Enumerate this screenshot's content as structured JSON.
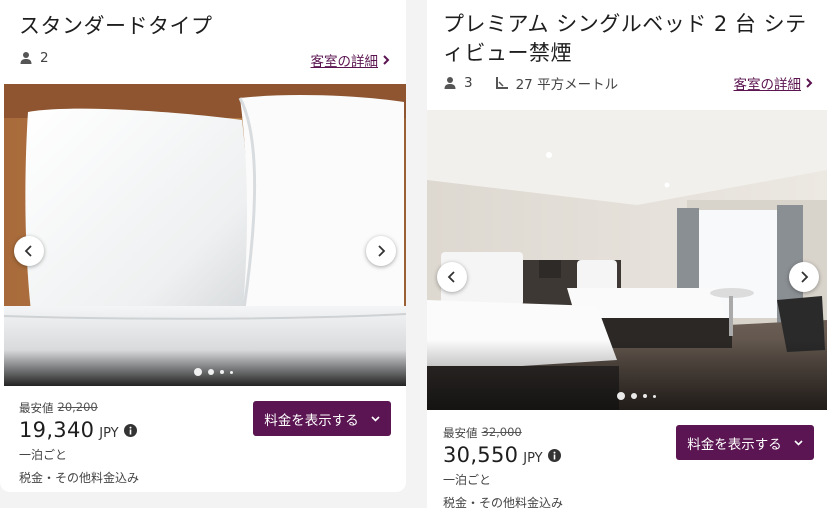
{
  "cards": [
    {
      "title": "スタンダードタイプ",
      "guests": "2",
      "details_link": "客室の詳細",
      "lowest_label": "最安値",
      "original_price": "20,200",
      "price": "19,340",
      "currency": "JPY",
      "per_night": "一泊ごと",
      "tax_note": "税金・その他料金込み",
      "rates_button": "料金を表示する",
      "image_index": 0,
      "image_count": 4
    },
    {
      "title": "プレミアム シングルベッド 2 台 シティビュー禁煙",
      "guests": "3",
      "room_size": "27 平方メートル",
      "details_link": "客室の詳細",
      "lowest_label": "最安値",
      "original_price": "32,000",
      "price": "30,550",
      "currency": "JPY",
      "per_night": "一泊ごと",
      "tax_note": "税金・その他料金込み",
      "rates_button": "料金を表示する",
      "image_index": 0,
      "image_count": 4
    }
  ],
  "icons": {
    "guest": "person-icon",
    "size": "area-icon",
    "details": "chevron-right-icon",
    "prev": "chevron-left-icon",
    "next": "chevron-right-icon",
    "info": "info-icon",
    "rates": "chevron-down-icon"
  },
  "colors": {
    "accent": "#5a1552",
    "link": "#5b1450"
  }
}
